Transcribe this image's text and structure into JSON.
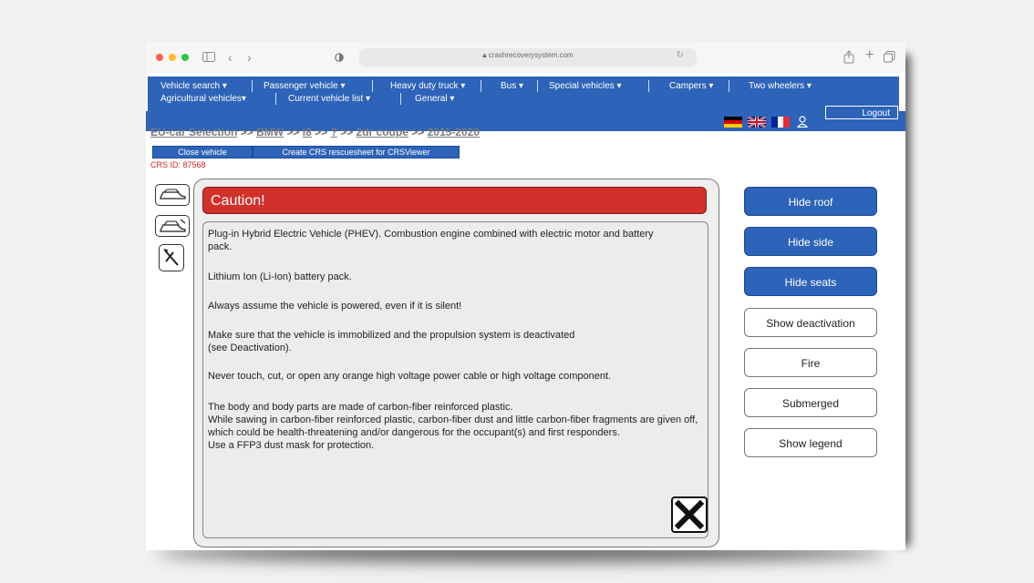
{
  "browser": {
    "url": "crashrecoverysystem.com",
    "traffic_colors": [
      "#ff5f57",
      "#febc2e",
      "#28c840"
    ]
  },
  "menu": {
    "row1": [
      "Vehicle search ▾",
      "Passenger vehicle ▾",
      "Heavy duty truck ▾",
      "Bus ▾",
      "Special vehicles ▾",
      "Campers ▾",
      "Two wheelers ▾"
    ],
    "row2": [
      "Agricultural vehicles▾",
      "Current vehicle list ▾",
      "General ▾"
    ],
    "logout": "Logout"
  },
  "breadcrumb": {
    "root": "EU-car Selection",
    "sep": ">>",
    "make": "BMW",
    "model": "i8",
    "unknown": "?",
    "body": "2dr coupe",
    "years": "2015-2020"
  },
  "actions": {
    "close_vehicle": "Close vehicle",
    "create_sheet": "Create CRS rescuesheet for CRSViewer"
  },
  "crs_id": "CRS ID: 87568",
  "caution": {
    "title": "Caution!",
    "paragraphs": [
      "Plug-in Hybrid Electric Vehicle (PHEV). Combustion engine combined with electric motor and battery pack.",
      "Lithium Ion (Li-Ion) battery pack.",
      "Always assume the vehicle is powered, even if it is silent!",
      "Make sure that the vehicle is immobilized and the propulsion system is deactivated\n(see Deactivation).",
      "Never touch, cut, or open any orange high voltage power cable or high voltage component.",
      "The body and body parts are made of carbon-fiber reinforced plastic.\nWhile sawing in carbon-fiber reinforced plastic, carbon-fiber dust and little carbon-fiber fragments are given off, which could be health-threatening and/or dangerous for the occupant(s) and first responders.\nUse a FFP3 dust mask for protection."
    ]
  },
  "right_buttons": [
    {
      "label": "Hide roof",
      "active": true
    },
    {
      "label": "Hide side",
      "active": true
    },
    {
      "label": "Hide seats",
      "active": true
    },
    {
      "label": "Show deactivation",
      "active": false
    },
    {
      "label": "Fire",
      "active": false
    },
    {
      "label": "Submerged",
      "active": false
    },
    {
      "label": "Show legend",
      "active": false
    }
  ],
  "colors": {
    "nav_blue": "#2d63b8",
    "caution_red": "#d1302b",
    "crs_red": "#d0281e"
  }
}
